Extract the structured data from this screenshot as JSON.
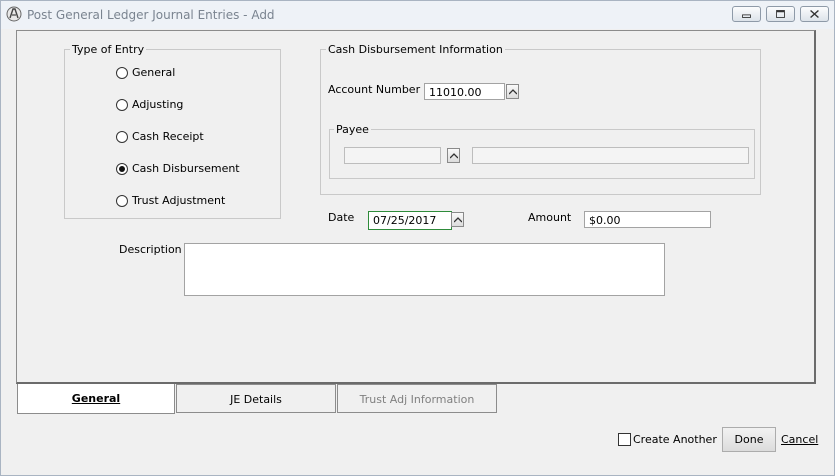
{
  "window": {
    "title": "Post General Ledger Journal Entries - Add"
  },
  "type_of_entry": {
    "legend": "Type of Entry",
    "options": [
      {
        "label": "General",
        "selected": false
      },
      {
        "label": "Adjusting",
        "selected": false
      },
      {
        "label": "Cash Receipt",
        "selected": false
      },
      {
        "label": "Cash Disbursement",
        "selected": true
      },
      {
        "label": "Trust Adjustment",
        "selected": false
      }
    ]
  },
  "cash_disbursement": {
    "legend": "Cash Disbursement Information",
    "account_number_label": "Account Number",
    "account_number_value": "11010.00",
    "payee": {
      "legend": "Payee",
      "code_value": "",
      "name_value": ""
    }
  },
  "date": {
    "label": "Date",
    "value": "07/25/2017"
  },
  "amount": {
    "label": "Amount",
    "value": "$0.00"
  },
  "description": {
    "label": "Description",
    "value": ""
  },
  "tabs": [
    {
      "label": "General",
      "active": true,
      "enabled": true
    },
    {
      "label": "JE Details",
      "active": false,
      "enabled": true
    },
    {
      "label": "Trust Adj Information",
      "active": false,
      "enabled": false
    }
  ],
  "footer": {
    "create_another_label": "Create Another",
    "create_another_checked": false,
    "done_label": "Done",
    "cancel_label": "Cancel"
  },
  "icons": {
    "app": "app-logo-icon",
    "minimize": "minimize-icon",
    "maximize": "maximize-icon",
    "close": "close-icon",
    "spin": "chevron-up-icon"
  }
}
